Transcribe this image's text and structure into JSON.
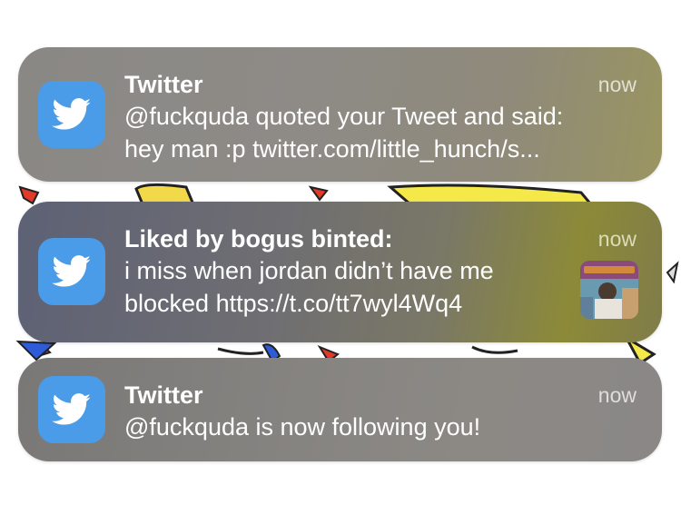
{
  "notifications": [
    {
      "app_icon": "twitter-bird-icon",
      "title": "Twitter",
      "time": "now",
      "lines": [
        "@fuckquda quoted your Tweet and said:",
        "hey man :p twitter.com/little_hunch/s..."
      ]
    },
    {
      "app_icon": "twitter-bird-icon",
      "title": "Liked by bogus binted:",
      "time": "now",
      "lines": [
        "i miss when jordan didn’t have me",
        "blocked https://t.co/tt7wyl4Wq4"
      ],
      "thumbnail": "tweet-image-thumbnail"
    },
    {
      "app_icon": "twitter-bird-icon",
      "title": "Twitter",
      "time": "now",
      "lines": [
        "@fuckquda is now following you!"
      ]
    }
  ],
  "colors": {
    "twitter_blue": "#4a9be8",
    "text": "#ffffff"
  }
}
